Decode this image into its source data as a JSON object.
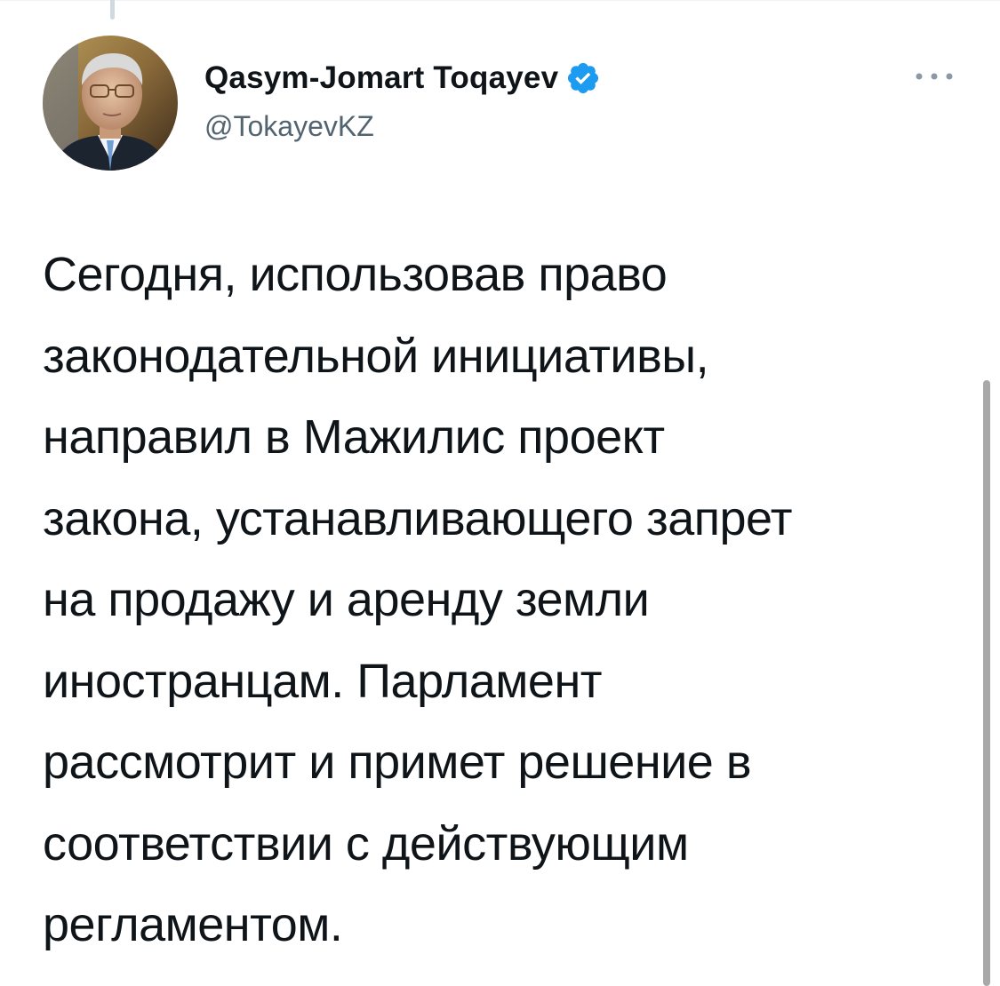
{
  "tweet": {
    "author": {
      "display_name": "Qasym-Jomart Toqayev",
      "handle": "@TokayevKZ",
      "verified": true,
      "verified_icon": "verified-badge-icon",
      "avatar_icon": "profile-photo"
    },
    "more_icon": "more-options-icon",
    "text_lines": [
      "Сегодня, использовав право",
      "законодательной инициативы,",
      "направил в Мажилис проект",
      "закона, устанавливающего запрет",
      "на продажу и аренду земли",
      "иностранцам. Парламент",
      "рассмотрит и примет решение в",
      "соответствии с действующим",
      "регламентом."
    ]
  },
  "colors": {
    "text_primary": "#0f1419",
    "text_secondary": "#536471",
    "accent": "#1d9bf0"
  }
}
